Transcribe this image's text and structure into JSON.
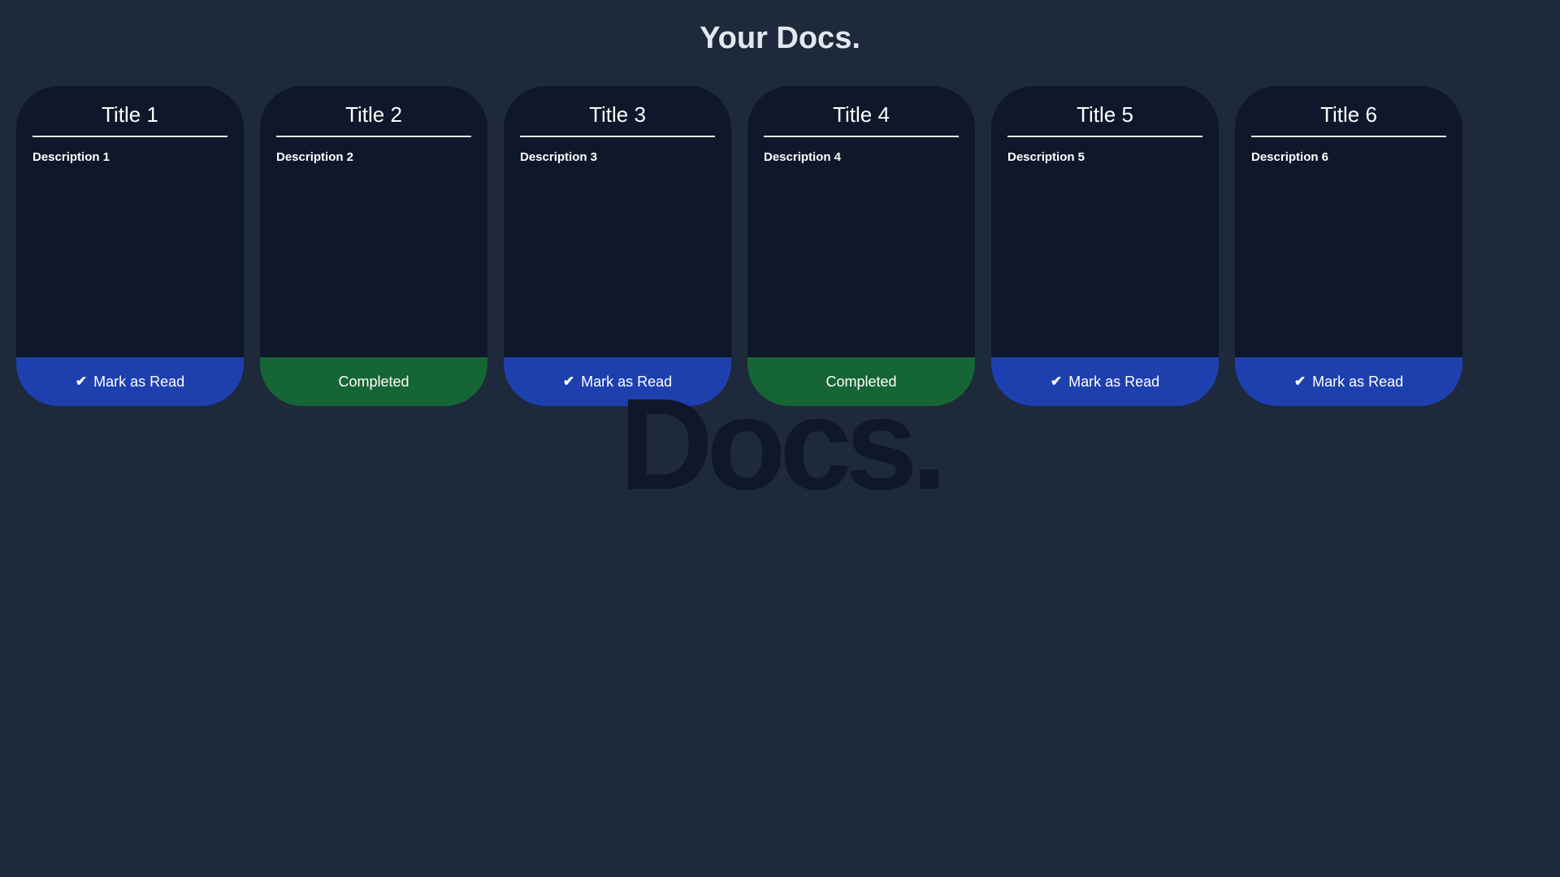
{
  "header": {
    "title": "Your Docs."
  },
  "watermark": "Docs.",
  "colors": {
    "background": "#1e293b",
    "card": "#0f172a",
    "mark_read": "#1e40af",
    "completed": "#166534"
  },
  "cards": [
    {
      "title": "Title 1",
      "description": "Description 1",
      "status": "unread",
      "button_label": "Mark as Read",
      "icon": "check-icon"
    },
    {
      "title": "Title 2",
      "description": "Description 2",
      "status": "completed",
      "button_label": "Completed"
    },
    {
      "title": "Title 3",
      "description": "Description 3",
      "status": "unread",
      "button_label": "Mark as Read",
      "icon": "check-icon"
    },
    {
      "title": "Title 4",
      "description": "Description 4",
      "status": "completed",
      "button_label": "Completed"
    },
    {
      "title": "Title 5",
      "description": "Description 5",
      "status": "unread",
      "button_label": "Mark as Read",
      "icon": "check-icon"
    },
    {
      "title": "Title 6",
      "description": "Description 6",
      "status": "unread",
      "button_label": "Mark as Read",
      "icon": "check-icon"
    }
  ]
}
